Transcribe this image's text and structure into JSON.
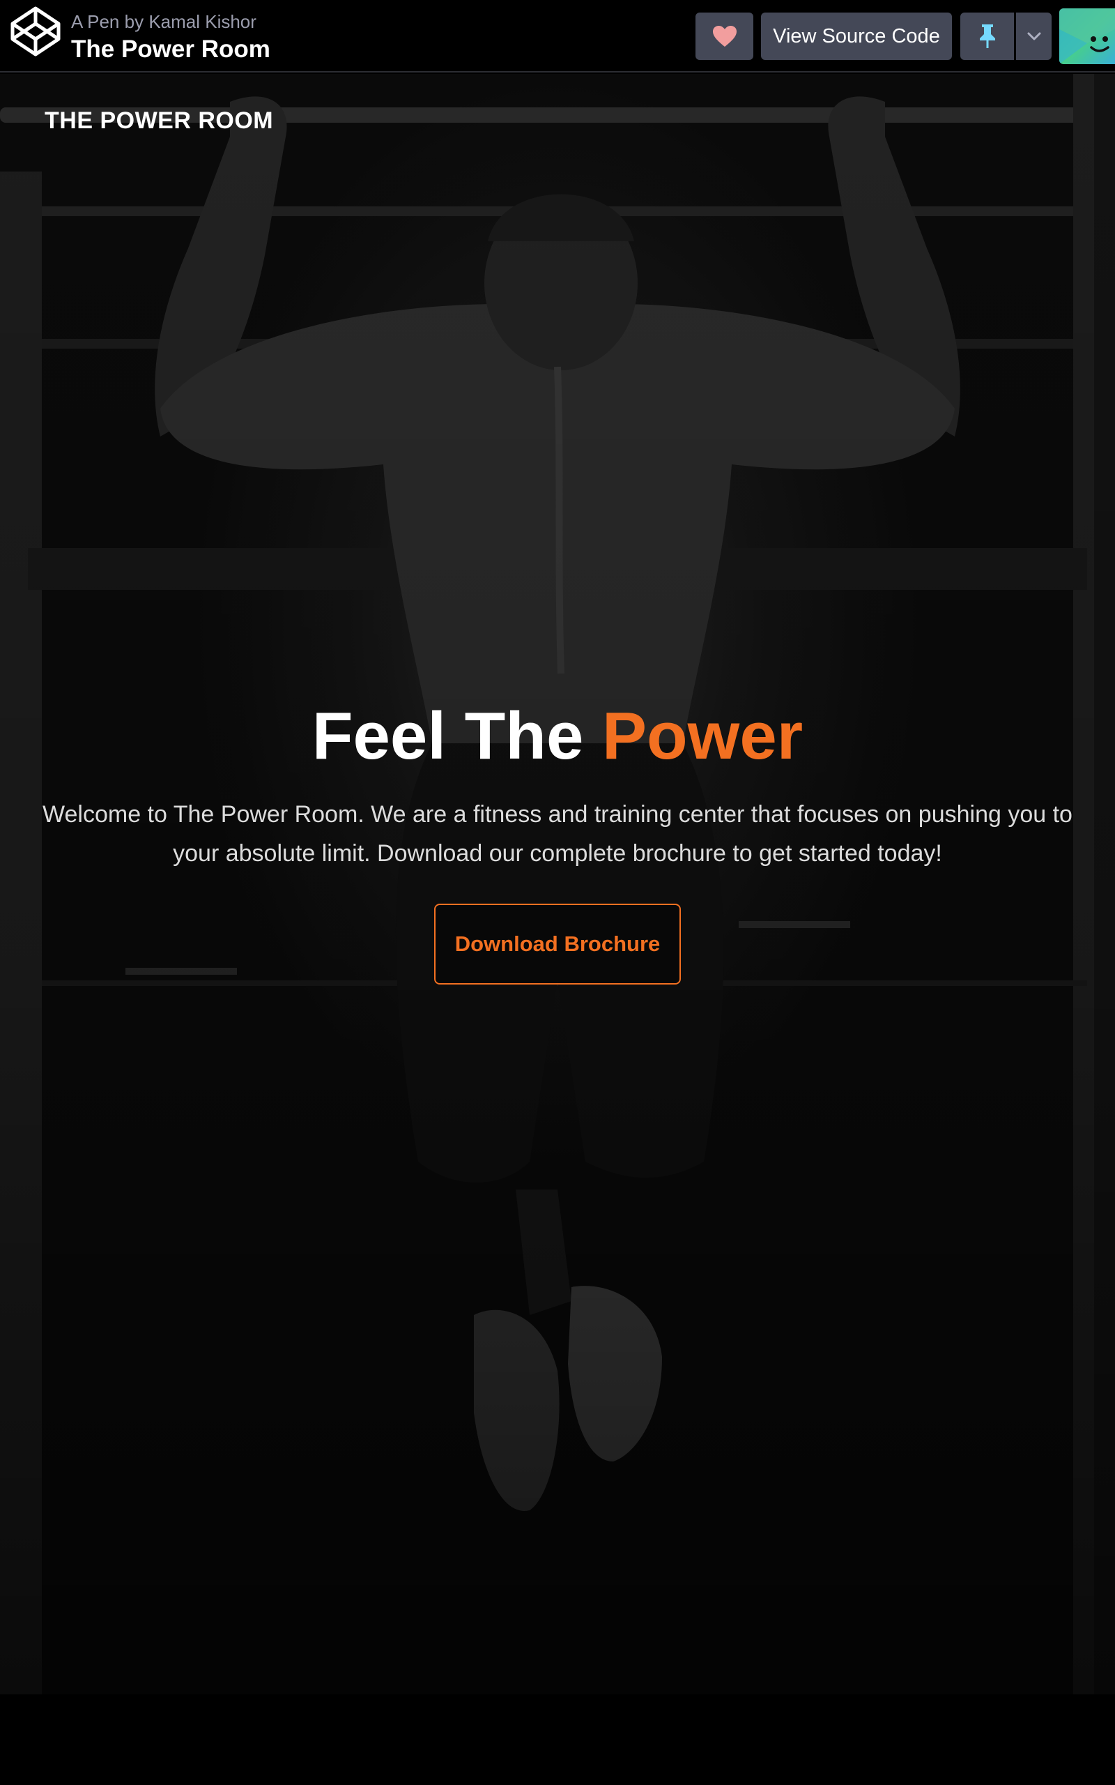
{
  "codepen": {
    "byline_prefix": "A Pen by",
    "author": "Kamal Kishor",
    "pen_title": "The Power Room",
    "view_source_label": "View Source Code",
    "icons": {
      "logo": "codepen-logo-icon",
      "heart": "heart-icon",
      "pin": "pin-icon",
      "dropdown": "chevron-down-icon",
      "avatar": "user-avatar"
    },
    "colors": {
      "heart": "#f29e9e",
      "pin": "#76daff",
      "button_bg": "#444857"
    }
  },
  "site": {
    "brand": "THE POWER ROOM",
    "hero": {
      "title_main": "Feel The",
      "title_accent": "Power",
      "description": "Welcome to The Power Room. We are a fitness and training center that focuses on pushing you to your absolute limit. Download our complete brochure to get started today!",
      "cta_label": "Download Brochure"
    },
    "colors": {
      "accent": "#f37021",
      "text": "#ffffff",
      "background": "#000000"
    }
  }
}
